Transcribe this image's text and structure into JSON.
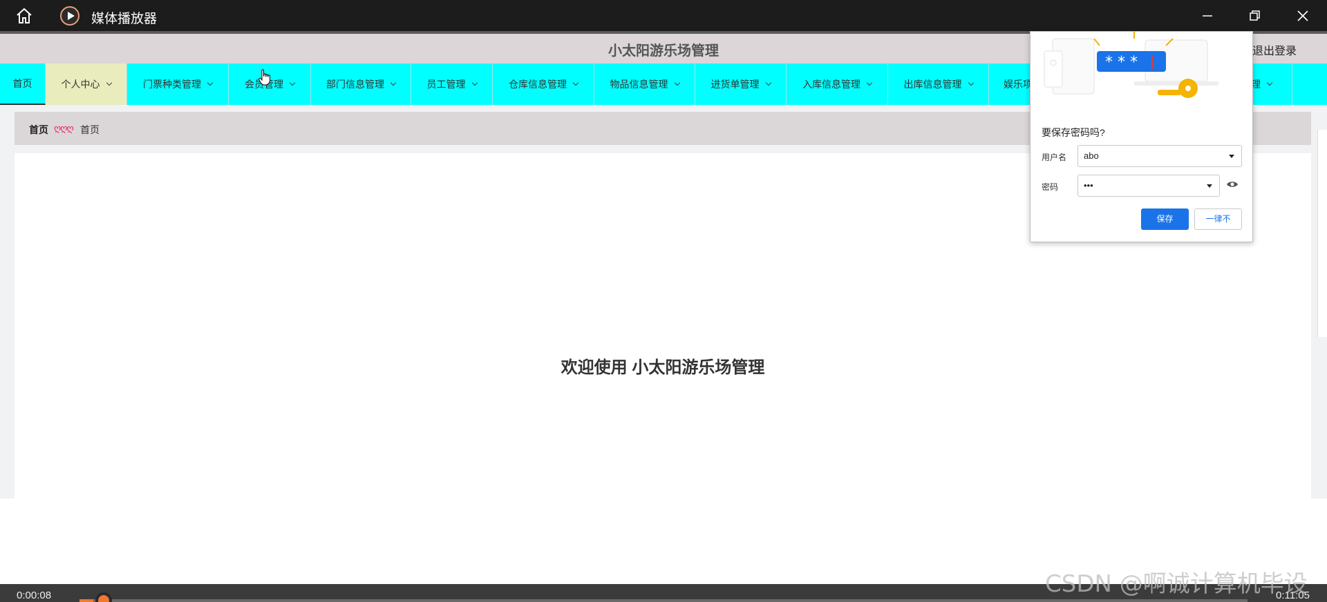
{
  "window": {
    "title": "媒体播放器"
  },
  "app": {
    "title": "小太阳游乐场管理",
    "logout": "退出登录"
  },
  "nav": {
    "items": [
      {
        "label": "首页",
        "dropdown": false
      },
      {
        "label": "个人中心",
        "dropdown": true
      },
      {
        "label": "门票种类管理",
        "dropdown": true
      },
      {
        "label": "会员管理",
        "dropdown": true
      },
      {
        "label": "部门信息管理",
        "dropdown": true
      },
      {
        "label": "员工管理",
        "dropdown": true
      },
      {
        "label": "仓库信息管理",
        "dropdown": true
      },
      {
        "label": "物品信息管理",
        "dropdown": true
      },
      {
        "label": "进货单管理",
        "dropdown": true
      },
      {
        "label": "入库信息管理",
        "dropdown": true
      },
      {
        "label": "出库信息管理",
        "dropdown": true
      },
      {
        "label": "娱乐项",
        "dropdown": false
      },
      {
        "label": "理",
        "dropdown": true
      }
    ]
  },
  "breadcrumb": {
    "root": "首页",
    "separator": "ღღღ",
    "current": "首页"
  },
  "welcome": "欢迎使用 小太阳游乐场管理",
  "password_dialog": {
    "question": "要保存密码吗?",
    "username_label": "用户名",
    "username_value": "abo",
    "password_label": "密码",
    "password_value": "•••",
    "illustration_text": "* * *",
    "save_button": "保存",
    "never_button": "一律不"
  },
  "player": {
    "current_time": "0:00:08",
    "total_time": "0:11:05",
    "progress": 0.012
  },
  "watermark": "CSDN @啊诚计算机毕设",
  "colors": {
    "nav_bg": "#00ffff",
    "nav_active": "#e9ecbd",
    "header_bg": "#dcd6d8",
    "accent": "#1a73e8",
    "player_accent": "#f07830"
  }
}
